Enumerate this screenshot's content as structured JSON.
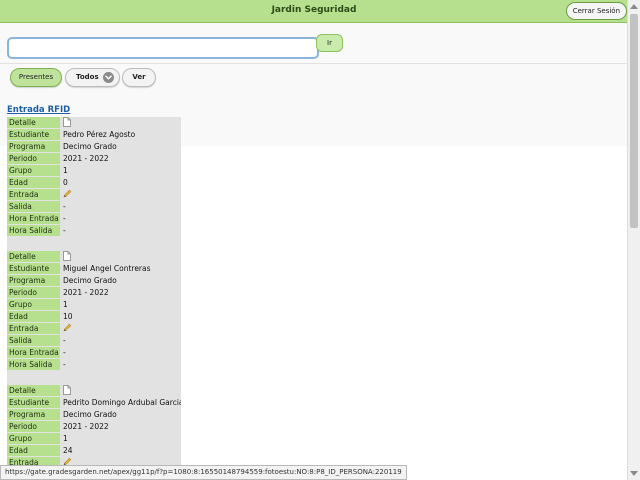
{
  "header": {
    "title": "Jardin Seguridad",
    "logout_label": "Cerrar Sesión"
  },
  "search": {
    "value": "",
    "placeholder": "",
    "go_label": "Ir"
  },
  "filters": {
    "presentes_label": "Presentes",
    "todos_label": "Todos",
    "ver_label": "Ver"
  },
  "link_rfid": "Entrada RFID",
  "records": [
    {
      "rows": [
        {
          "key": "Detalle",
          "value": "",
          "icon": "document-icon"
        },
        {
          "key": "Estudiante",
          "value": "Pedro Pérez Agosto"
        },
        {
          "key": "Programa",
          "value": "Decimo Grado"
        },
        {
          "key": "Periodo",
          "value": "2021 - 2022"
        },
        {
          "key": "Grupo",
          "value": "1"
        },
        {
          "key": "Edad",
          "value": "0"
        },
        {
          "key": "Entrada",
          "value": "",
          "icon": "pencil-icon"
        },
        {
          "key": "Salida",
          "value": "-"
        },
        {
          "key": "Hora Entrada",
          "value": "-"
        },
        {
          "key": "Hora Salida",
          "value": "-"
        }
      ]
    },
    {
      "rows": [
        {
          "key": "Detalle",
          "value": "",
          "icon": "document-icon"
        },
        {
          "key": "Estudiante",
          "value": "Miguel Angel Contreras"
        },
        {
          "key": "Programa",
          "value": "Decimo Grado"
        },
        {
          "key": "Periodo",
          "value": "2021 - 2022"
        },
        {
          "key": "Grupo",
          "value": "1"
        },
        {
          "key": "Edad",
          "value": "10"
        },
        {
          "key": "Entrada",
          "value": "",
          "icon": "pencil-icon"
        },
        {
          "key": "Salida",
          "value": "-"
        },
        {
          "key": "Hora Entrada",
          "value": "-"
        },
        {
          "key": "Hora Salida",
          "value": "-"
        }
      ]
    },
    {
      "rows": [
        {
          "key": "Detalle",
          "value": "",
          "icon": "document-icon"
        },
        {
          "key": "Estudiante",
          "value": "Pedrito Domingo Ardubal Garcia"
        },
        {
          "key": "Programa",
          "value": "Decimo Grado"
        },
        {
          "key": "Periodo",
          "value": "2021 - 2022"
        },
        {
          "key": "Grupo",
          "value": "1"
        },
        {
          "key": "Edad",
          "value": "24"
        },
        {
          "key": "Entrada",
          "value": "",
          "icon": "pencil-icon"
        }
      ]
    }
  ],
  "status_url": "https://gate.gradesgarden.net/apex/gg11p/f?p=1080:8:16550148794559:fotoestu:NO:8:P8_ID_PERSONA:220119",
  "colors": {
    "accent_green": "#b6e08d",
    "link_blue": "#1f5fa6"
  }
}
